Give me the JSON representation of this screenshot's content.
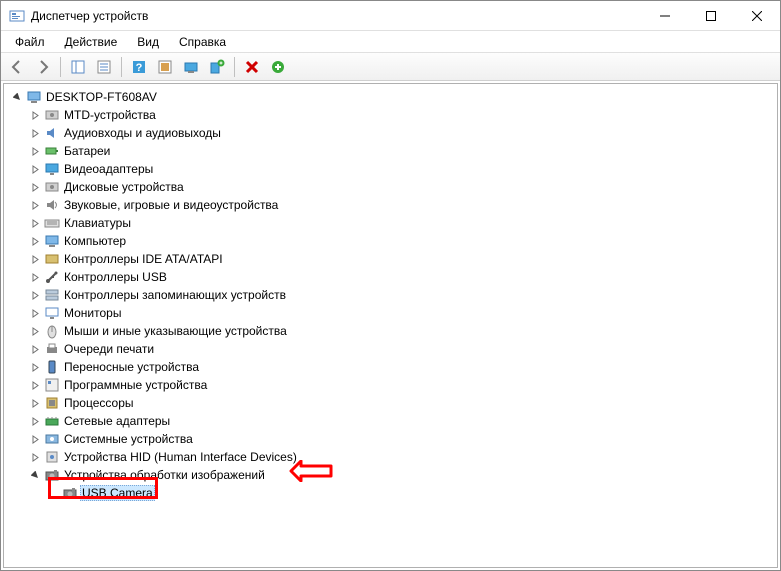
{
  "window": {
    "title": "Диспетчер устройств"
  },
  "menu": {
    "file": "Файл",
    "action": "Действие",
    "view": "Вид",
    "help": "Справка"
  },
  "toolbar_icons": {
    "back": "back-icon",
    "forward": "forward-icon",
    "show_hide": "show-hide-icon",
    "properties": "properties-icon",
    "help": "help-icon",
    "scan": "scan-icon",
    "update": "update-icon",
    "uninstall_device": "uninstall-device-icon",
    "disable": "disable-icon",
    "enable": "enable-icon"
  },
  "tree": {
    "root": "DESKTOP-FT608AV",
    "categories": [
      {
        "label": "MTD-устройства",
        "icon": "disk"
      },
      {
        "label": "Аудиовходы и аудиовыходы",
        "icon": "audio"
      },
      {
        "label": "Батареи",
        "icon": "battery"
      },
      {
        "label": "Видеоадаптеры",
        "icon": "display"
      },
      {
        "label": "Дисковые устройства",
        "icon": "disk"
      },
      {
        "label": "Звуковые, игровые и видеоустройства",
        "icon": "sound"
      },
      {
        "label": "Клавиатуры",
        "icon": "keyboard"
      },
      {
        "label": "Компьютер",
        "icon": "computer"
      },
      {
        "label": "Контроллеры IDE ATA/ATAPI",
        "icon": "ide"
      },
      {
        "label": "Контроллеры USB",
        "icon": "usb"
      },
      {
        "label": "Контроллеры запоминающих устройств",
        "icon": "storage"
      },
      {
        "label": "Мониторы",
        "icon": "monitor"
      },
      {
        "label": "Мыши и иные указывающие устройства",
        "icon": "mouse"
      },
      {
        "label": "Очереди печати",
        "icon": "printer"
      },
      {
        "label": "Переносные устройства",
        "icon": "portable"
      },
      {
        "label": "Программные устройства",
        "icon": "software"
      },
      {
        "label": "Процессоры",
        "icon": "cpu"
      },
      {
        "label": "Сетевые адаптеры",
        "icon": "network"
      },
      {
        "label": "Системные устройства",
        "icon": "system"
      },
      {
        "label": "Устройства HID (Human Interface Devices)",
        "icon": "hid"
      },
      {
        "label": "Устройства обработки изображений",
        "icon": "imaging",
        "expanded": true,
        "children": [
          {
            "label": "USB Camera",
            "icon": "camera",
            "selected": true
          }
        ]
      }
    ]
  }
}
